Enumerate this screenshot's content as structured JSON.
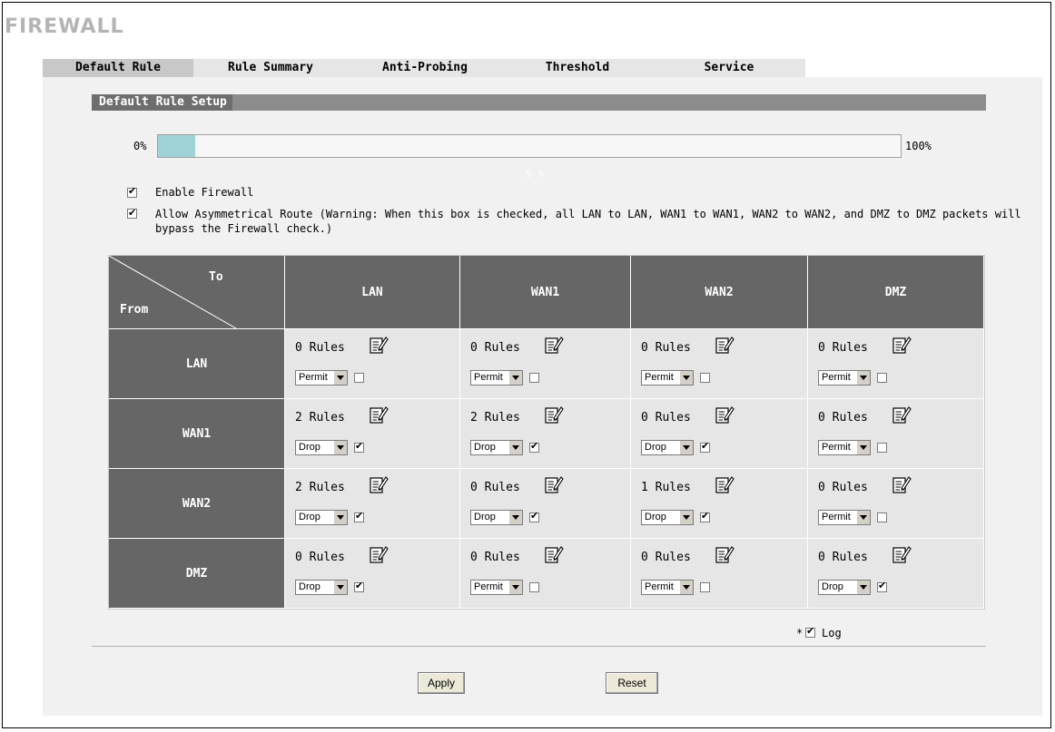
{
  "page": {
    "title": "FIREWALL"
  },
  "tabs": [
    {
      "label": "Default Rule",
      "active": true
    },
    {
      "label": "Rule Summary",
      "active": false
    },
    {
      "label": "Anti-Probing",
      "active": false
    },
    {
      "label": "Threshold",
      "active": false
    },
    {
      "label": "Service",
      "active": false
    }
  ],
  "section": {
    "title": "Default Rule Setup"
  },
  "progress": {
    "min_label": "0%",
    "max_label": "100%",
    "value_percent": 5,
    "value_text": "5 %"
  },
  "options": {
    "enable_firewall": {
      "label": "Enable Firewall",
      "checked": true
    },
    "asymmetrical_route": {
      "label": "Allow Asymmetrical Route (Warning: When this box is checked, all LAN to LAN, WAN1 to WAN1, WAN2 to WAN2, and DMZ to DMZ packets will bypass the Firewall check.)",
      "checked": true
    }
  },
  "matrix": {
    "corner_to": "To",
    "corner_from": "From",
    "columns": [
      "LAN",
      "WAN1",
      "WAN2",
      "DMZ"
    ],
    "rows": [
      {
        "label": "LAN",
        "cells": [
          {
            "rules": "0 Rules",
            "action": "Permit",
            "log": false
          },
          {
            "rules": "0 Rules",
            "action": "Permit",
            "log": false
          },
          {
            "rules": "0 Rules",
            "action": "Permit",
            "log": false
          },
          {
            "rules": "0 Rules",
            "action": "Permit",
            "log": false
          }
        ]
      },
      {
        "label": "WAN1",
        "cells": [
          {
            "rules": "2 Rules",
            "action": "Drop",
            "log": true
          },
          {
            "rules": "2 Rules",
            "action": "Drop",
            "log": true
          },
          {
            "rules": "0 Rules",
            "action": "Drop",
            "log": true
          },
          {
            "rules": "0 Rules",
            "action": "Permit",
            "log": false
          }
        ]
      },
      {
        "label": "WAN2",
        "cells": [
          {
            "rules": "2 Rules",
            "action": "Drop",
            "log": true
          },
          {
            "rules": "0 Rules",
            "action": "Drop",
            "log": true
          },
          {
            "rules": "1 Rules",
            "action": "Drop",
            "log": true
          },
          {
            "rules": "0 Rules",
            "action": "Permit",
            "log": false
          }
        ]
      },
      {
        "label": "DMZ",
        "cells": [
          {
            "rules": "0 Rules",
            "action": "Drop",
            "log": true
          },
          {
            "rules": "0 Rules",
            "action": "Permit",
            "log": false
          },
          {
            "rules": "0 Rules",
            "action": "Permit",
            "log": false
          },
          {
            "rules": "0 Rules",
            "action": "Drop",
            "log": true
          }
        ]
      }
    ]
  },
  "legend": {
    "star": "*",
    "label": "Log",
    "checked": true
  },
  "buttons": {
    "apply": "Apply",
    "reset": "Reset"
  },
  "colors": {
    "header_bg": "#666666",
    "cell_bg": "#e6e6e6",
    "progress_fill": "#9fd2d6",
    "panel_bg": "#f1f1f1"
  }
}
